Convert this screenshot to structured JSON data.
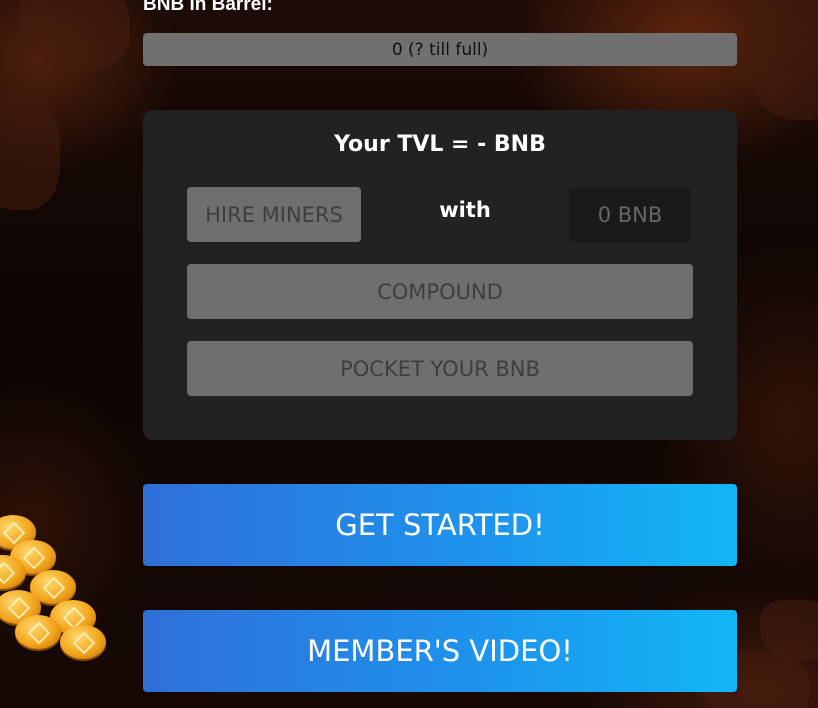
{
  "barrel": {
    "label": "BNB In Barrel:",
    "status_text": "0 (? till full)",
    "fill_fraction": 0
  },
  "panel": {
    "tvl_text": "Your TVL = - BNB",
    "hire_label": "HIRE MINERS",
    "with_label": "with",
    "amount_placeholder": "0 BNB",
    "compound_label": "COMPOUND",
    "pocket_label": "POCKET YOUR BNB"
  },
  "actions": {
    "get_started_label": "GET STARTED!",
    "video_label": "MEMBER'S VIDEO!"
  },
  "colors": {
    "accent_start": "#2f6fd8",
    "accent_end": "#12b6f6",
    "disabled_button": "#6f6f6f",
    "panel_bg": "#222222"
  },
  "decor": {
    "coin_icon": "bnb-coin-icon"
  }
}
